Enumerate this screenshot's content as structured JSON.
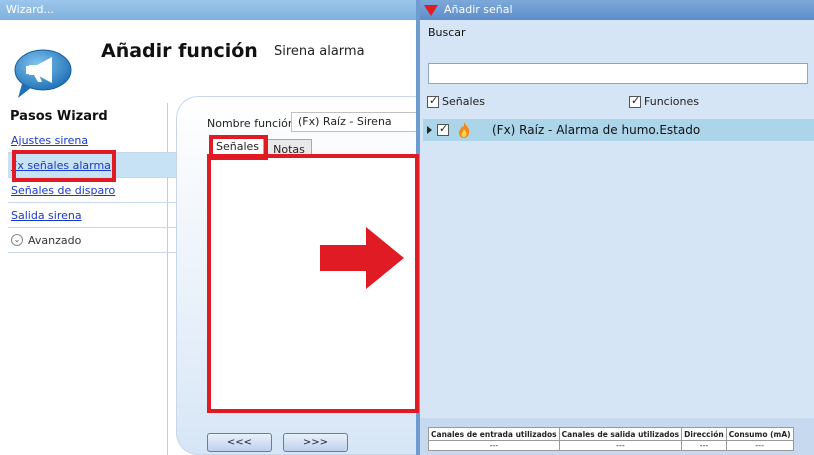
{
  "wizard": {
    "window_title": "Wizard...",
    "title": "Añadir función",
    "subtitle": "Sirena alarma",
    "steps_heading": "Pasos Wizard",
    "steps": [
      {
        "label": "Ajustes sirena",
        "active": false
      },
      {
        "label": "Fx señales alarma",
        "active": true
      },
      {
        "label": "Señales de disparo",
        "active": false
      },
      {
        "label": "Salida sirena",
        "active": false
      }
    ],
    "advanced_label": "Avanzado",
    "function_name_label": "Nombre función:",
    "function_name_value": "(Fx) Raíz - Sirena",
    "tabs": [
      "Señales",
      "Notas"
    ],
    "back_button": "<<<",
    "next_button": ">>>"
  },
  "signal_window": {
    "title": "Añadir señal",
    "search_label": "Buscar",
    "search_value": "",
    "filter_signals": {
      "label": "Señales",
      "checked": true
    },
    "filter_functions": {
      "label": "Funciones",
      "checked": true
    },
    "tree": [
      {
        "label": "(Fx) Raíz - Alarma de humo.Estado",
        "checked": true,
        "icon": "fire-icon"
      }
    ],
    "table": {
      "headers": [
        "Canales de entrada utilizados",
        "Canales de salida utilizados",
        "Dirección",
        "Consumo (mA)"
      ],
      "row": [
        "---",
        "---",
        "---",
        "---"
      ]
    }
  },
  "colors": {
    "highlight": "#e01b24",
    "selected_row": "#acd5ea",
    "panel_bg": "#d5e5f6",
    "link": "#1a38c9"
  }
}
